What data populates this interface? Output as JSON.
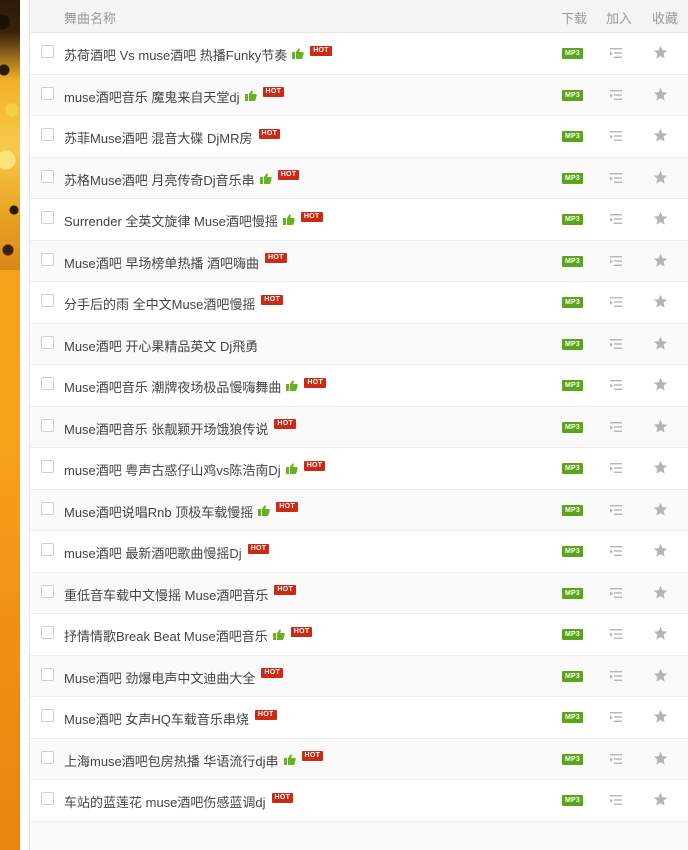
{
  "header": {
    "name": "舞曲名称",
    "download": "下载",
    "add": "加入",
    "favorite": "收藏"
  },
  "hot_label": "HOT",
  "mp3_label": "MP3",
  "colors": {
    "hot": "#cc2a14",
    "mp3": "#5aa518",
    "thumb": "#6ab023",
    "icon_gray": "#b5b5b5"
  },
  "songs": [
    {
      "title": "苏荷酒吧 Vs muse酒吧 热播Funky节奏",
      "thumb": true,
      "hot": true
    },
    {
      "title": "muse酒吧音乐 魔鬼来自天堂dj",
      "thumb": true,
      "hot": true
    },
    {
      "title": "苏菲Muse酒吧 混音大碟 DjMR房",
      "thumb": false,
      "hot": true
    },
    {
      "title": "苏格Muse酒吧 月亮传奇Dj音乐串",
      "thumb": true,
      "hot": true
    },
    {
      "title": "Surrender 全英文旋律 Muse酒吧慢摇",
      "thumb": true,
      "hot": true
    },
    {
      "title": "Muse酒吧 早场榜单热播 酒吧嗨曲",
      "thumb": false,
      "hot": true
    },
    {
      "title": "分手后的雨 全中文Muse酒吧慢摇",
      "thumb": false,
      "hot": true
    },
    {
      "title": "Muse酒吧 开心果精品英文 Dj飛勇",
      "thumb": false,
      "hot": false
    },
    {
      "title": "Muse酒吧音乐 潮牌夜场极品慢嗨舞曲",
      "thumb": true,
      "hot": true
    },
    {
      "title": "Muse酒吧音乐 张靓颖开场饿狼传说",
      "thumb": false,
      "hot": true
    },
    {
      "title": "muse酒吧 粤声古惑仔山鸡vs陈浩南Dj",
      "thumb": true,
      "hot": true
    },
    {
      "title": "Muse酒吧说唱Rnb 顶极车载慢摇",
      "thumb": true,
      "hot": true
    },
    {
      "title": "muse酒吧 最新酒吧歌曲慢摇Dj",
      "thumb": false,
      "hot": true
    },
    {
      "title": "重低音车载中文慢摇 Muse酒吧音乐",
      "thumb": false,
      "hot": true
    },
    {
      "title": "抒情情歌Break Beat Muse酒吧音乐",
      "thumb": true,
      "hot": true
    },
    {
      "title": "Muse酒吧 劲爆电声中文迪曲大全",
      "thumb": false,
      "hot": true
    },
    {
      "title": "Muse酒吧 女声HQ车载音乐串烧",
      "thumb": false,
      "hot": true
    },
    {
      "title": "上海muse酒吧包房热播 华语流行dj串",
      "thumb": true,
      "hot": true
    },
    {
      "title": "车站的蓝莲花 muse酒吧伤感蓝调dj",
      "thumb": false,
      "hot": true
    }
  ]
}
